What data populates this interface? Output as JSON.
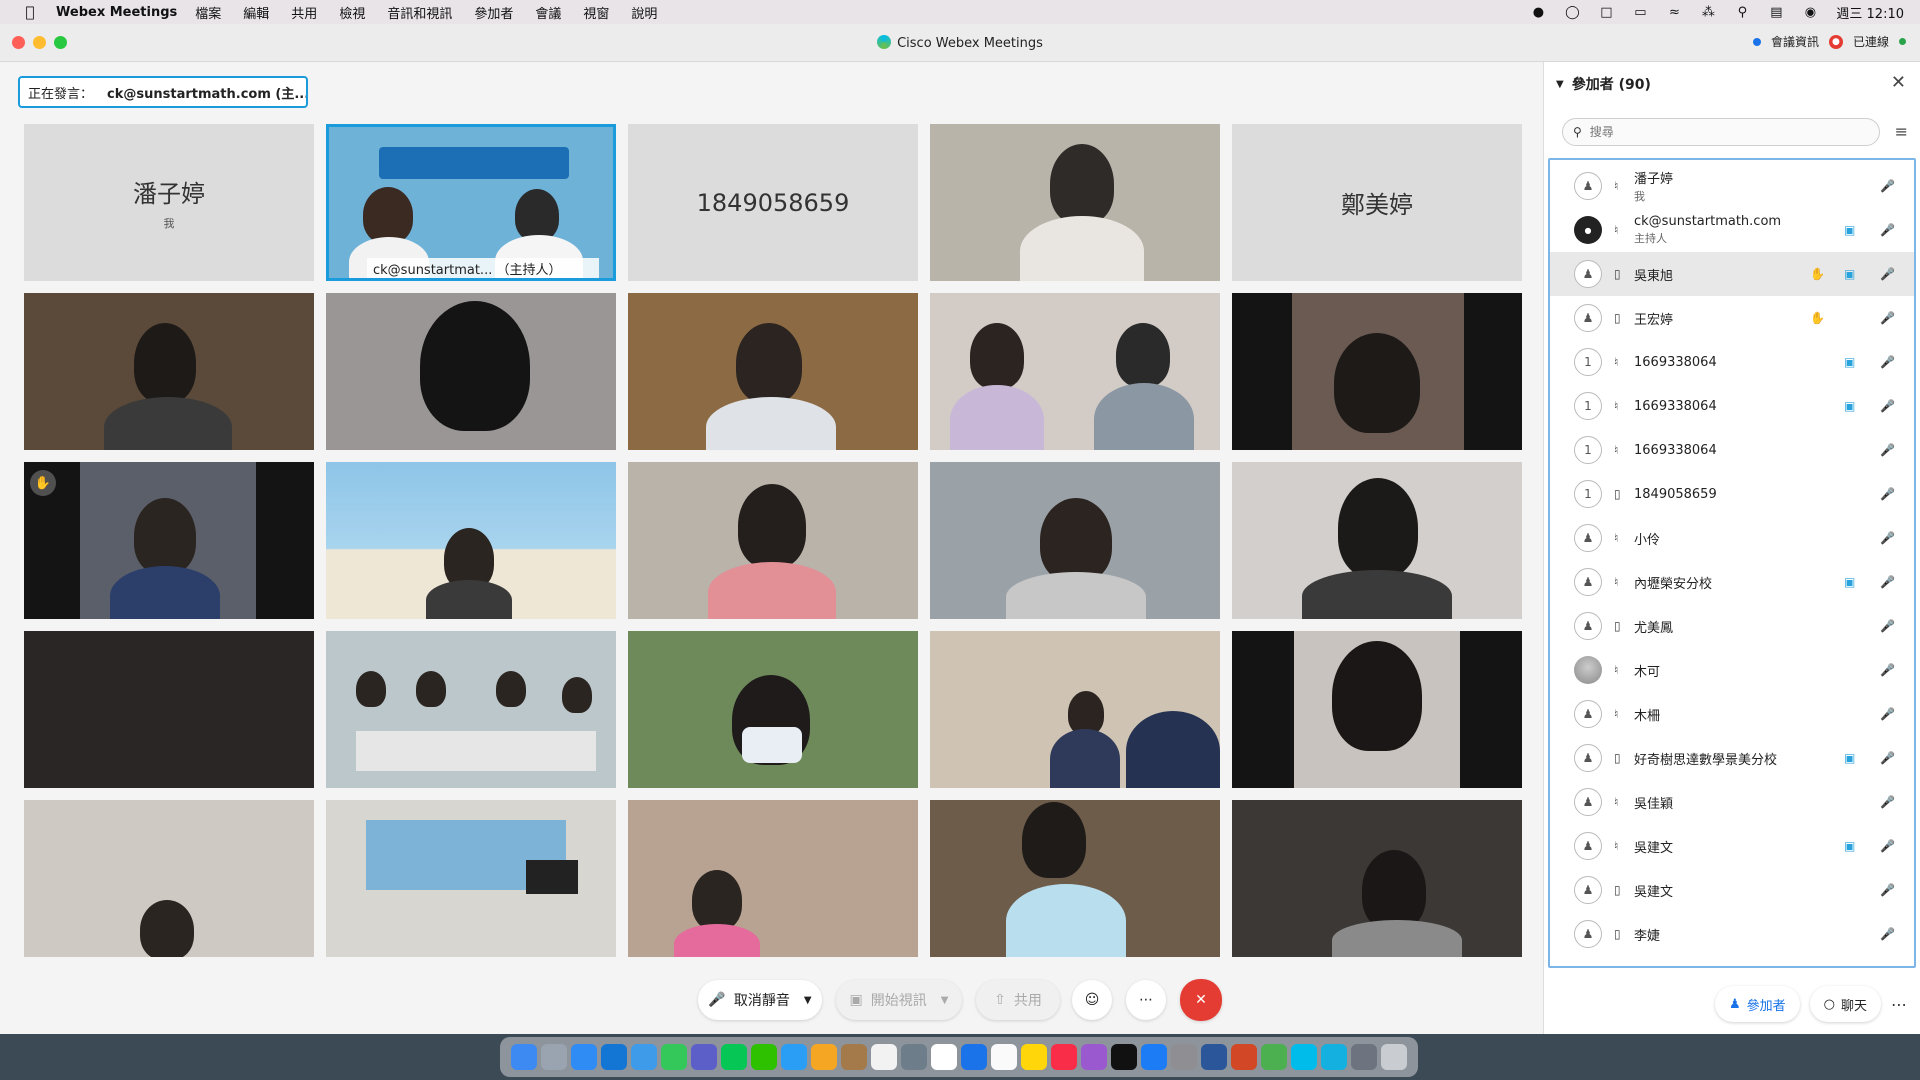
{
  "menubar": {
    "app_name": "Webex Meetings",
    "menus": [
      "檔案",
      "編輯",
      "共用",
      "檢視",
      "音訊和視訊",
      "參加者",
      "會議",
      "視窗",
      "說明"
    ],
    "clock": "週三 12:10"
  },
  "window": {
    "title": "Cisco Webex Meetings",
    "meeting_info": "會議資訊",
    "connected": "已連線"
  },
  "speaking": {
    "label": "正在發言：",
    "value": "ck@sunstartmath.com (主..."
  },
  "tiles": {
    "t1_name": "潘子婷",
    "t1_sub": "我",
    "t2_caption": "ck@sunstartmat...  （主持人）",
    "t3_name": "1849058659",
    "t5_name": "鄭美婷"
  },
  "controls": {
    "unmute": "取消靜音",
    "start_video": "開始視訊",
    "share": "共用"
  },
  "participants": {
    "title": "參加者 (90)",
    "search_placeholder": "搜尋",
    "rows": [
      {
        "name": "潘子婷",
        "role": "我"
      },
      {
        "name": "ck@sunstartmath.com",
        "role": "主持人"
      },
      {
        "name": "吳東旭"
      },
      {
        "name": "王宏婷"
      },
      {
        "name": "1669338064",
        "badge": "1"
      },
      {
        "name": "1669338064",
        "badge": "1"
      },
      {
        "name": "1669338064",
        "badge": "1"
      },
      {
        "name": "1849058659",
        "badge": "1"
      },
      {
        "name": "小伶"
      },
      {
        "name": "內壢榮安分校"
      },
      {
        "name": "尤美鳳"
      },
      {
        "name": "木可"
      },
      {
        "name": "木柵"
      },
      {
        "name": "好奇樹思達數學景美分校"
      },
      {
        "name": "吳佳穎"
      },
      {
        "name": "吳建文"
      },
      {
        "name": "吳建文"
      },
      {
        "name": "李婕"
      }
    ],
    "footer_participants": "參加者",
    "footer_chat": "聊天"
  },
  "colors": {
    "accent": "#1a9bdc",
    "end_call": "#e43c33"
  }
}
